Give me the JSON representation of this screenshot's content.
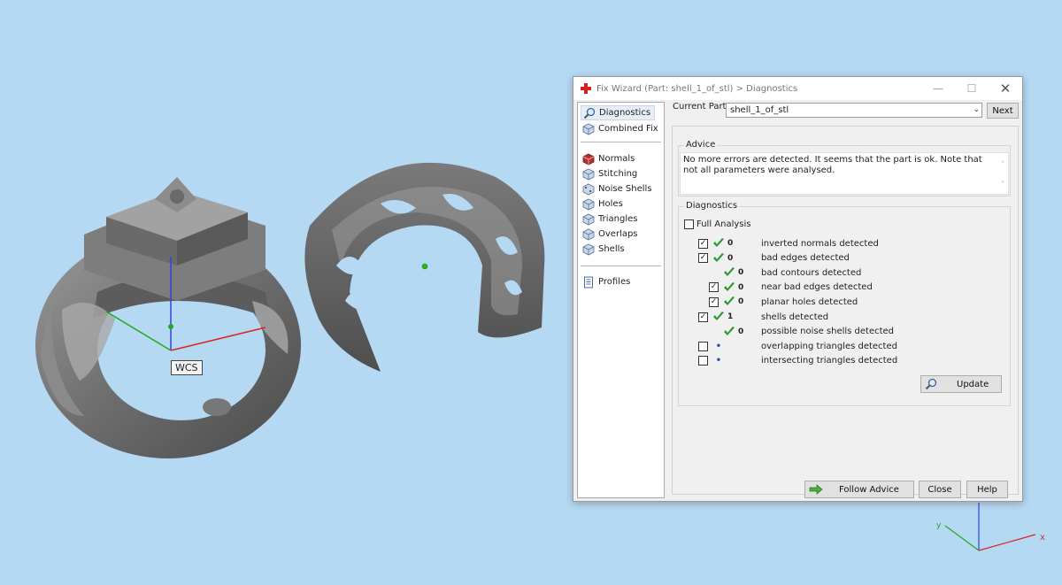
{
  "viewport": {
    "wcs_label": "WCS"
  },
  "window": {
    "title": "Fix Wizard (Part: shell_1_of_stl) > Diagnostics",
    "controls": {
      "minimize": "—",
      "maximize": "☐",
      "close": "✕"
    }
  },
  "nav": {
    "group1": [
      {
        "label": "Diagnostics",
        "icon": "magnifier-icon"
      },
      {
        "label": "Combined Fix",
        "icon": "cube-icon"
      }
    ],
    "group2": [
      {
        "label": "Normals",
        "icon": "cube-red-icon"
      },
      {
        "label": "Stitching",
        "icon": "cube-icon"
      },
      {
        "label": "Noise Shells",
        "icon": "cube-icon"
      },
      {
        "label": "Holes",
        "icon": "cube-icon"
      },
      {
        "label": "Triangles",
        "icon": "cube-icon"
      },
      {
        "label": "Overlaps",
        "icon": "cube-icon"
      },
      {
        "label": "Shells",
        "icon": "cube-icon"
      }
    ],
    "group3": [
      {
        "label": "Profiles",
        "icon": "document-icon"
      }
    ]
  },
  "current_part": {
    "label": "Current Part:",
    "value": "shell_1_of_stl",
    "next_label": "Next"
  },
  "advice": {
    "title": "Advice",
    "text": "No more errors are detected. It seems that the part is ok. Note that not all parameters were analysed."
  },
  "diagnostics": {
    "title": "Diagnostics",
    "full_analysis_label": "Full Analysis",
    "rows": [
      {
        "checked": true,
        "ok": true,
        "count": "0",
        "label": "inverted normals detected"
      },
      {
        "checked": true,
        "ok": true,
        "count": "0",
        "label": "bad edges detected"
      },
      {
        "checked": null,
        "ok": true,
        "count": "0",
        "label": "bad contours detected"
      },
      {
        "checked": true,
        "ok": true,
        "count": "0",
        "label": "near bad edges detected"
      },
      {
        "checked": true,
        "ok": true,
        "count": "0",
        "label": "planar holes detected"
      },
      {
        "checked": true,
        "ok": true,
        "count": "1",
        "label": "shells detected"
      },
      {
        "checked": null,
        "ok": true,
        "count": "0",
        "label": "possible noise shells detected"
      },
      {
        "checked": false,
        "ok": false,
        "count": "",
        "label": "overlapping triangles detected"
      },
      {
        "checked": false,
        "ok": false,
        "count": "",
        "label": "intersecting triangles detected"
      }
    ],
    "update_label": "Update"
  },
  "footer": {
    "follow_advice_label": "Follow Advice",
    "close_label": "Close",
    "help_label": "Help"
  },
  "colors": {
    "background": "#b5d8f3",
    "ok_check": "#2a9a2a",
    "title_icon": "#d62020"
  }
}
